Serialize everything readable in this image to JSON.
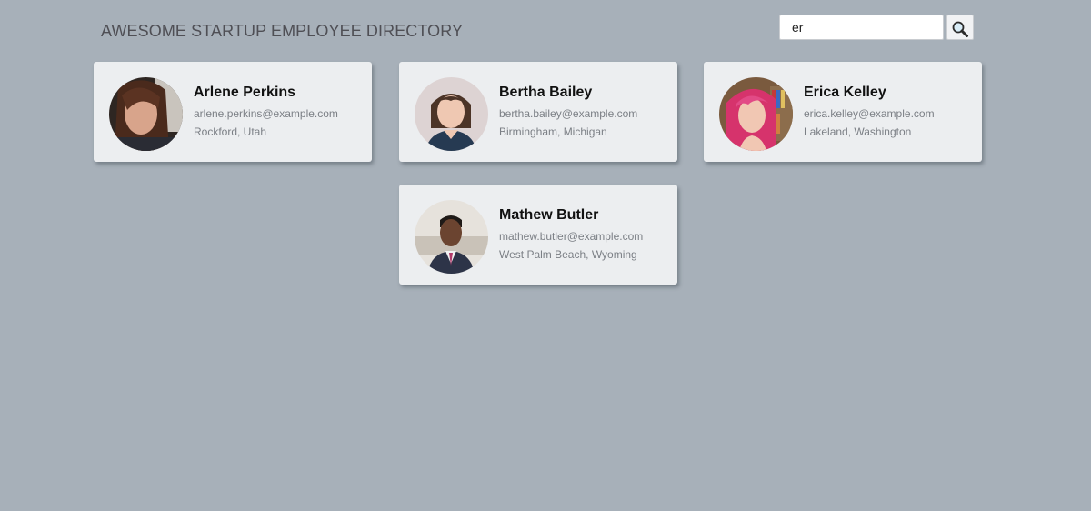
{
  "header": {
    "title": "AWESOME STARTUP EMPLOYEE DIRECTORY"
  },
  "search": {
    "value": "er",
    "button_icon": "magnifier-icon"
  },
  "employees": [
    {
      "name": "Arlene Perkins",
      "email": "arlene.perkins@example.com",
      "location": "Rockford, Utah"
    },
    {
      "name": "Bertha Bailey",
      "email": "bertha.bailey@example.com",
      "location": "Birmingham, Michigan"
    },
    {
      "name": "Erica Kelley",
      "email": "erica.kelley@example.com",
      "location": "Lakeland, Washington"
    },
    {
      "name": "Mathew Butler",
      "email": "mathew.butler@example.com",
      "location": "West Palm Beach, Wyoming"
    }
  ],
  "colors": {
    "background": "#a7b0b9",
    "card": "#eceef0",
    "title": "#4f4f55"
  }
}
